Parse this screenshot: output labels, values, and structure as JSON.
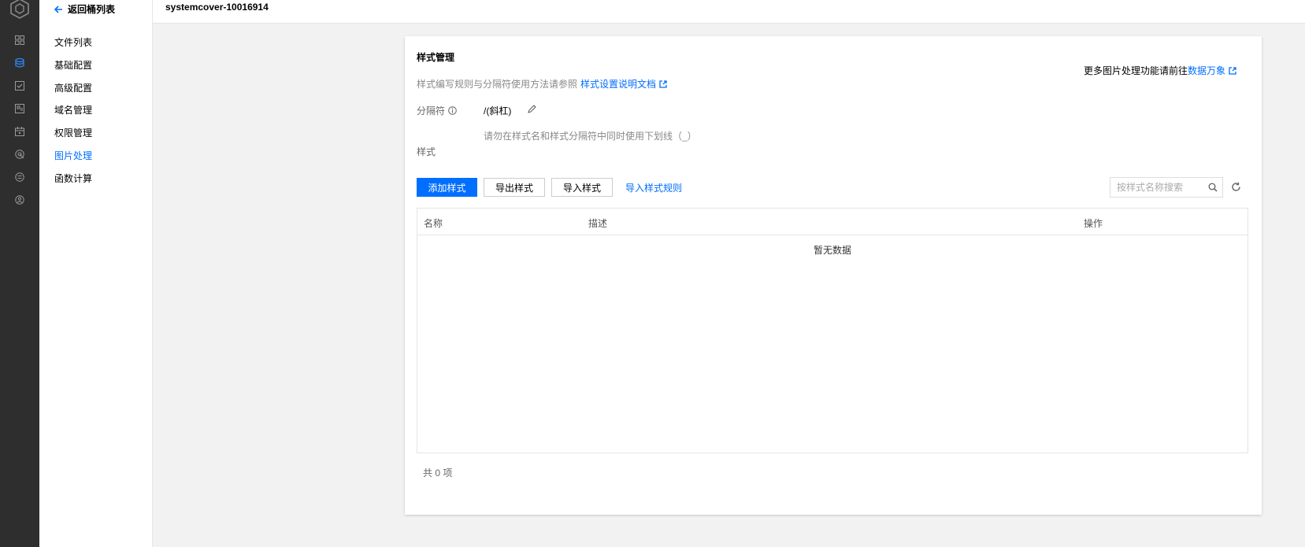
{
  "rail": {
    "icons": [
      "cube-logo-icon",
      "grid-icon",
      "database-icon",
      "checklist-icon",
      "monitor-icon",
      "calendar-icon",
      "target-icon",
      "list-circle-icon",
      "person-circle-icon"
    ],
    "active_index": 2
  },
  "menu": {
    "back_label": "返回桶列表",
    "items": [
      {
        "label": "文件列表"
      },
      {
        "label": "基础配置"
      },
      {
        "label": "高级配置"
      },
      {
        "label": "域名管理"
      },
      {
        "label": "权限管理"
      },
      {
        "label": "图片处理"
      },
      {
        "label": "函数计算"
      }
    ],
    "active_index": 5
  },
  "header": {
    "title": "systemcover-10016914"
  },
  "card": {
    "title": "样式管理",
    "right_hint_prefix": "更多图片处理功能请前往",
    "right_hint_link": "数据万象",
    "desc_text": "样式编写规则与分隔符使用方法请参照",
    "desc_link": "样式设置说明文档",
    "separator_label": "分隔符",
    "separator_value": "/(斜杠)",
    "warning": "请勿在样式名和样式分隔符中同时使用下划线（_）",
    "style_label": "样式",
    "buttons": {
      "add": "添加样式",
      "export": "导出样式",
      "import": "导入样式",
      "import_rules": "导入样式规则"
    },
    "search_placeholder": "按样式名称搜索",
    "table": {
      "columns": [
        "名称",
        "描述",
        "操作"
      ],
      "empty_text": "暂无数据"
    },
    "total": "共 0 项"
  },
  "colors": {
    "accent": "#006eff",
    "rail_bg": "#2e2e2e",
    "page_bg": "#f2f2f2"
  }
}
